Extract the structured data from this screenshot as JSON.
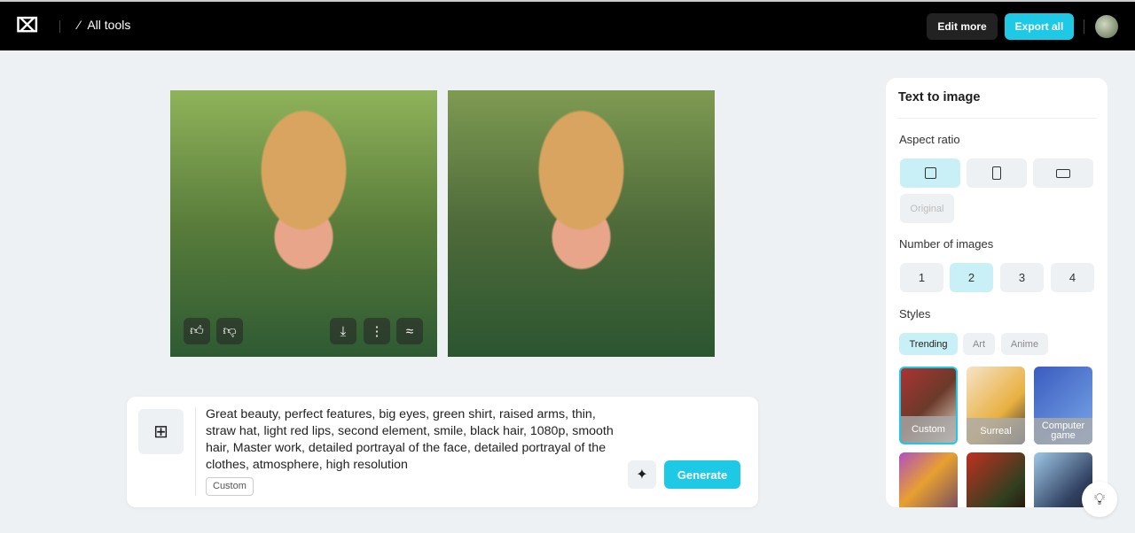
{
  "header": {
    "all_tools": "All tools",
    "edit_more": "Edit more",
    "export_all": "Export all"
  },
  "prompt": {
    "text": "Great beauty, perfect features, big eyes, green shirt, raised arms, thin, straw hat, light red lips, second element, smile, black hair, 1080p, smooth hair, Master work, detailed portrayal of the face, detailed portrayal of the clothes, atmosphere, high resolution",
    "style_tag": "Custom",
    "generate": "Generate"
  },
  "panel": {
    "title": "Text to image",
    "aspect_label": "Aspect ratio",
    "aspect_selected": "square",
    "original": "Original",
    "num_label": "Number of images",
    "numbers": [
      "1",
      "2",
      "3",
      "4"
    ],
    "num_selected": "2",
    "styles_label": "Styles",
    "style_tabs": [
      "Trending",
      "Art",
      "Anime"
    ],
    "style_tab_selected": "Trending",
    "styles": [
      {
        "label": "Custom"
      },
      {
        "label": "Surreal"
      },
      {
        "label": "Computer game"
      }
    ]
  },
  "colors": {
    "accent": "#1ec9e6",
    "selected_bg": "#c9f0f6"
  }
}
